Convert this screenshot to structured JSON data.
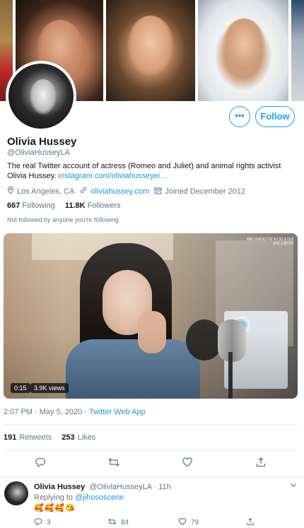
{
  "profile": {
    "name": "Olivia Hussey",
    "handle": "@OliviaHusseyLA",
    "bio_text": "The real Twitter account of actress (Romeo and Juliet) and animal rights activist Olivia Hussey.",
    "bio_link": "instagram.com/oliviahusseyei...",
    "location": "Los Angeles, CA",
    "website": "oliviahussey.com",
    "joined": "Joined December 2012",
    "following_count": "667",
    "following_label": "Following",
    "followers_count": "11.8K",
    "followers_label": "Followers",
    "not_followed": "Not followed by anyone you're following"
  },
  "buttons": {
    "more_label": "•••",
    "follow_label": "Follow"
  },
  "icons": {
    "location": "location-pin-icon",
    "link": "link-icon",
    "calendar": "calendar-icon",
    "reply": "reply-icon",
    "retweet": "retweet-icon",
    "like": "heart-icon",
    "share": "share-icon",
    "chevron": "chevron-down-icon"
  },
  "video": {
    "time": "0:15",
    "views": "3.9K views",
    "overlay_logo": "MBC RADIO FM 4U 91.9 이재라의 스탑하우"
  },
  "tweet": {
    "timestamp": "2:07 PM · May 5, 2020 ·",
    "app": "Twitter Web App",
    "retweets_count": "191",
    "retweets_label": "Retweets",
    "likes_count": "253",
    "likes_label": "Likes"
  },
  "reply": {
    "name": "Olivia Hussey",
    "handle_time": "@OliviaHusseyLA · 11h",
    "replying_prefix": "Replying to",
    "replying_to": "@jihososcene",
    "text": "🥰🥰🥰😘",
    "reply_count": "3",
    "retweet_count": "84",
    "like_count": "79"
  },
  "colors": {
    "accent": "#1da1f2",
    "link": "#1b95e0",
    "secondary_text": "#657786"
  }
}
